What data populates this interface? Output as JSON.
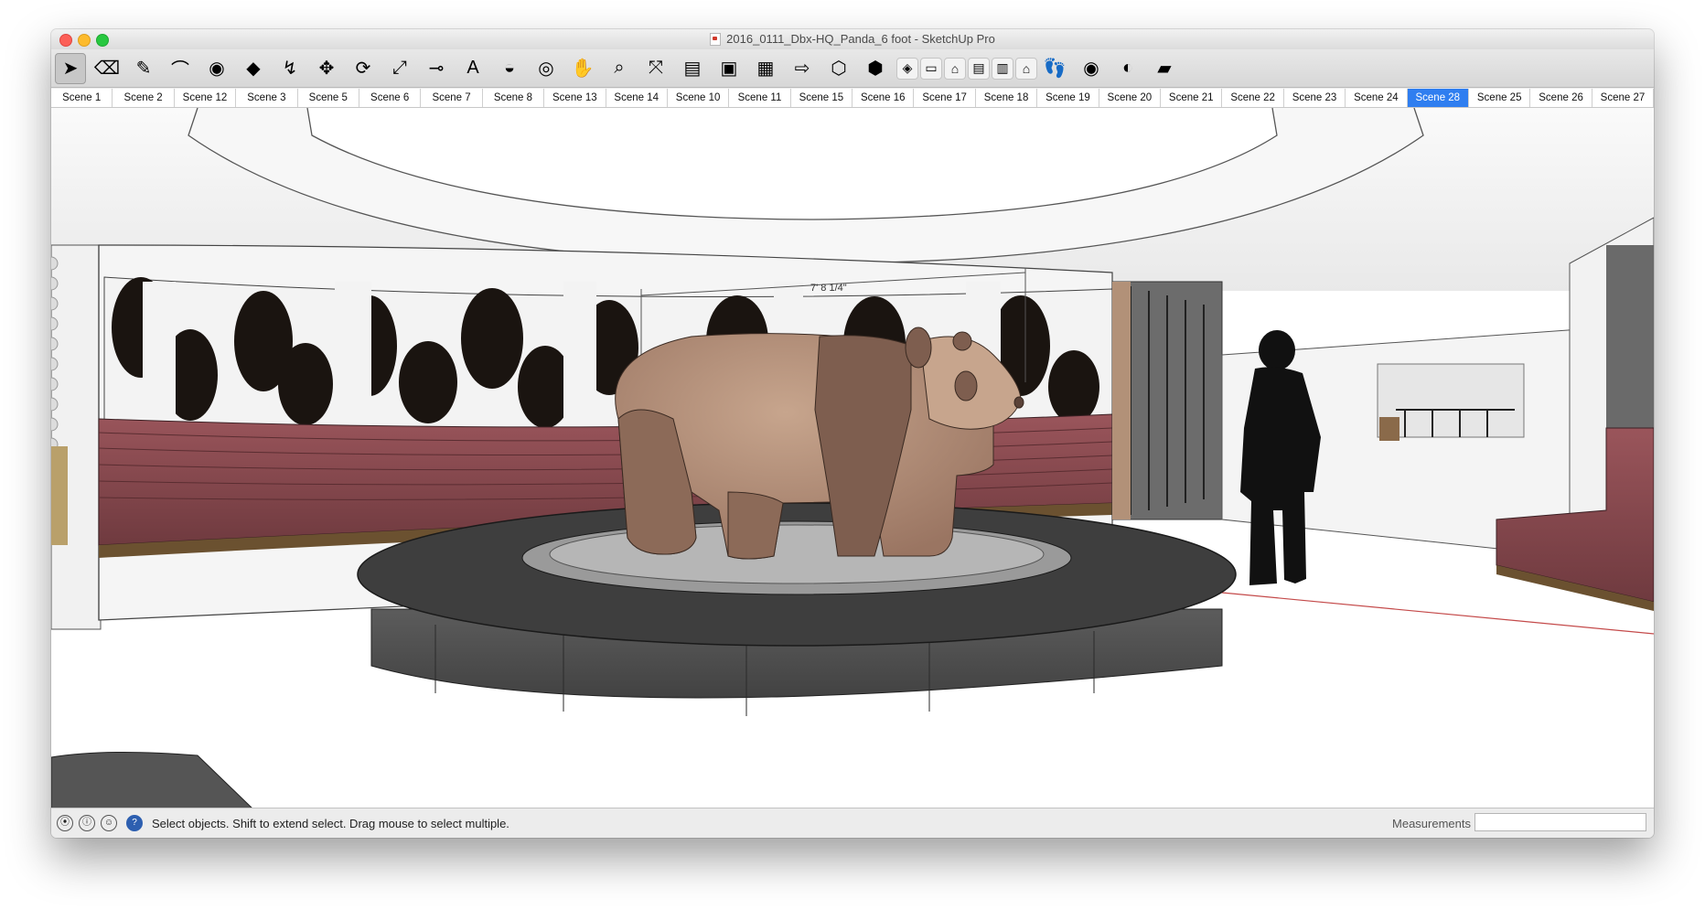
{
  "window": {
    "title": "2016_0111_Dbx-HQ_Panda_6 foot - SketchUp Pro"
  },
  "toolbar": {
    "tools": [
      {
        "name": "select-tool-icon",
        "glyph": "➤",
        "active": true
      },
      {
        "name": "eraser-tool-icon",
        "glyph": "⌫"
      },
      {
        "name": "pencil-tool-icon",
        "glyph": "✎"
      },
      {
        "name": "arc-tool-icon",
        "glyph": "⌒"
      },
      {
        "name": "circle-tool-icon",
        "glyph": "◉"
      },
      {
        "name": "push-pull-tool-icon",
        "glyph": "◆"
      },
      {
        "name": "follow-me-tool-icon",
        "glyph": "↯"
      },
      {
        "name": "move-tool-icon",
        "glyph": "✥"
      },
      {
        "name": "rotate-tool-icon",
        "glyph": "⟳"
      },
      {
        "name": "scale-tool-icon",
        "glyph": "⤢"
      },
      {
        "name": "tape-measure-tool-icon",
        "glyph": "⊸"
      },
      {
        "name": "text-tool-icon",
        "glyph": "A"
      },
      {
        "name": "paint-bucket-tool-icon",
        "glyph": "◒"
      },
      {
        "name": "orbit-tool-icon",
        "glyph": "◎"
      },
      {
        "name": "pan-tool-icon",
        "glyph": "✋"
      },
      {
        "name": "zoom-tool-icon",
        "glyph": "⌕"
      },
      {
        "name": "zoom-extents-tool-icon",
        "glyph": "⤧"
      },
      {
        "name": "warehouse-icon",
        "glyph": "▤"
      },
      {
        "name": "share-model-icon",
        "glyph": "▣"
      },
      {
        "name": "extension-warehouse-icon",
        "glyph": "▦"
      },
      {
        "name": "layout-send-icon",
        "glyph": "⇨"
      },
      {
        "name": "section-plane-icon",
        "glyph": "⬡"
      },
      {
        "name": "section-cut-icon",
        "glyph": "⬢"
      }
    ],
    "view_tools": [
      {
        "name": "iso-view-icon",
        "glyph": "◈"
      },
      {
        "name": "top-view-icon",
        "glyph": "▭"
      },
      {
        "name": "front-view-icon",
        "glyph": "⌂"
      },
      {
        "name": "right-view-icon",
        "glyph": "▤"
      },
      {
        "name": "back-view-icon",
        "glyph": "▥"
      },
      {
        "name": "left-view-icon",
        "glyph": "⌂"
      }
    ],
    "extra_tools": [
      {
        "name": "walk-tool-icon",
        "glyph": "👣"
      },
      {
        "name": "look-around-tool-icon",
        "glyph": "◉"
      },
      {
        "name": "position-camera-icon",
        "glyph": "◐"
      },
      {
        "name": "styles-icon",
        "glyph": "▰"
      }
    ]
  },
  "scenes": [
    "Scene 1",
    "Scene 2",
    "Scene 12",
    "Scene 3",
    "Scene 5",
    "Scene 6",
    "Scene 7",
    "Scene 8",
    "Scene 13",
    "Scene 14",
    "Scene 10",
    "Scene 11",
    "Scene 15",
    "Scene 16",
    "Scene 17",
    "Scene 18",
    "Scene 19",
    "Scene 20",
    "Scene 21",
    "Scene 22",
    "Scene 23",
    "Scene 24",
    "Scene 28",
    "Scene 25",
    "Scene 26",
    "Scene 27"
  ],
  "selected_scene": "Scene 28",
  "viewport": {
    "dimension_label": "7' 8 1/4\""
  },
  "statusbar": {
    "message": "Select objects. Shift to extend select. Drag mouse to select multiple.",
    "measurements_label": "Measurements",
    "measurements_value": ""
  },
  "colors": {
    "selected_tab": "#2f7ef0",
    "banquette": "#8a4a4f",
    "panda_light": "#b08a72",
    "panda_dark": "#7e5e4f",
    "pedestal": "#3a3a3a"
  }
}
